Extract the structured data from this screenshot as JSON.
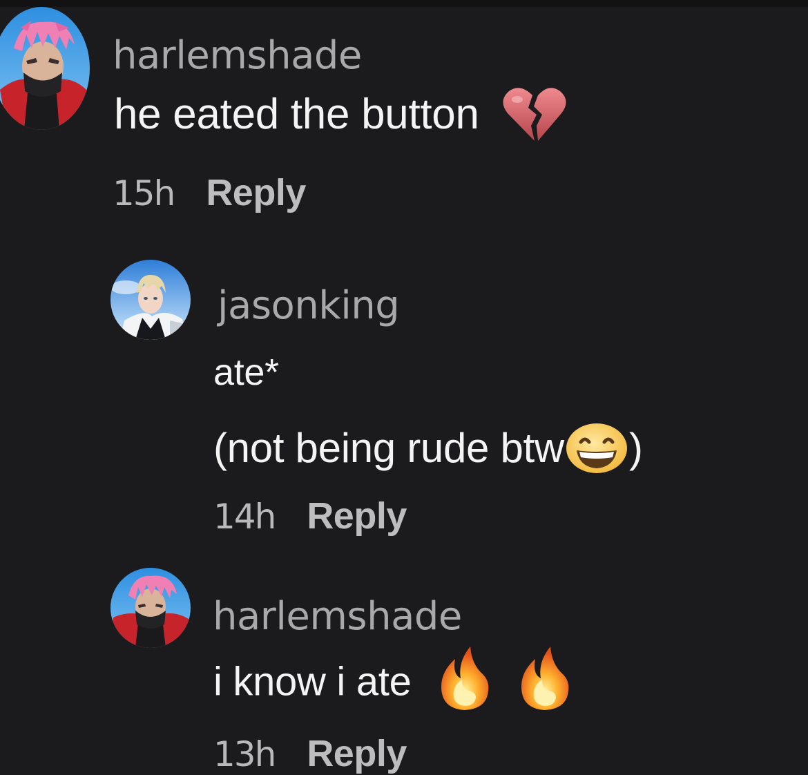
{
  "comments": [
    {
      "username": "harlemshade",
      "text": "he eated the button",
      "emoji": "broken-heart-icon",
      "time": "15h",
      "reply_label": "Reply"
    },
    {
      "username": "jasonking",
      "text_line1": "ate*",
      "text_line2": "(not being rude btw",
      "text_line2_end": ")",
      "emoji": "grinning-face-icon",
      "time": "14h",
      "reply_label": "Reply"
    },
    {
      "username": "harlemshade",
      "text": "i know i ate",
      "emoji": "fire-icon",
      "time": "13h",
      "reply_label": "Reply"
    }
  ],
  "colors": {
    "background": "#1b1b1d",
    "username": "#a9a9ab",
    "text": "#f4f4f4",
    "meta": "#b9b9bb"
  }
}
